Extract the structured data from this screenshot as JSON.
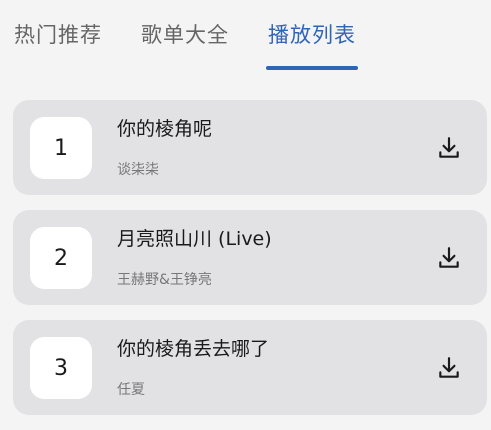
{
  "tabs": [
    {
      "label": "热门推荐",
      "active": false
    },
    {
      "label": "歌单大全",
      "active": false
    },
    {
      "label": "播放列表",
      "active": true
    }
  ],
  "colors": {
    "accent": "#2f65b5",
    "card_background": "#e2e2e4",
    "page_background": "#f4f4f5"
  },
  "songs": [
    {
      "rank": "1",
      "title": "你的棱角呢",
      "artist": "谈柒柒",
      "action_icon": "download-icon"
    },
    {
      "rank": "2",
      "title": "月亮照山川 (Live)",
      "artist": "王赫野&王铮亮",
      "action_icon": "download-icon"
    },
    {
      "rank": "3",
      "title": "你的棱角丢去哪了",
      "artist": "任夏",
      "action_icon": "download-icon"
    }
  ]
}
